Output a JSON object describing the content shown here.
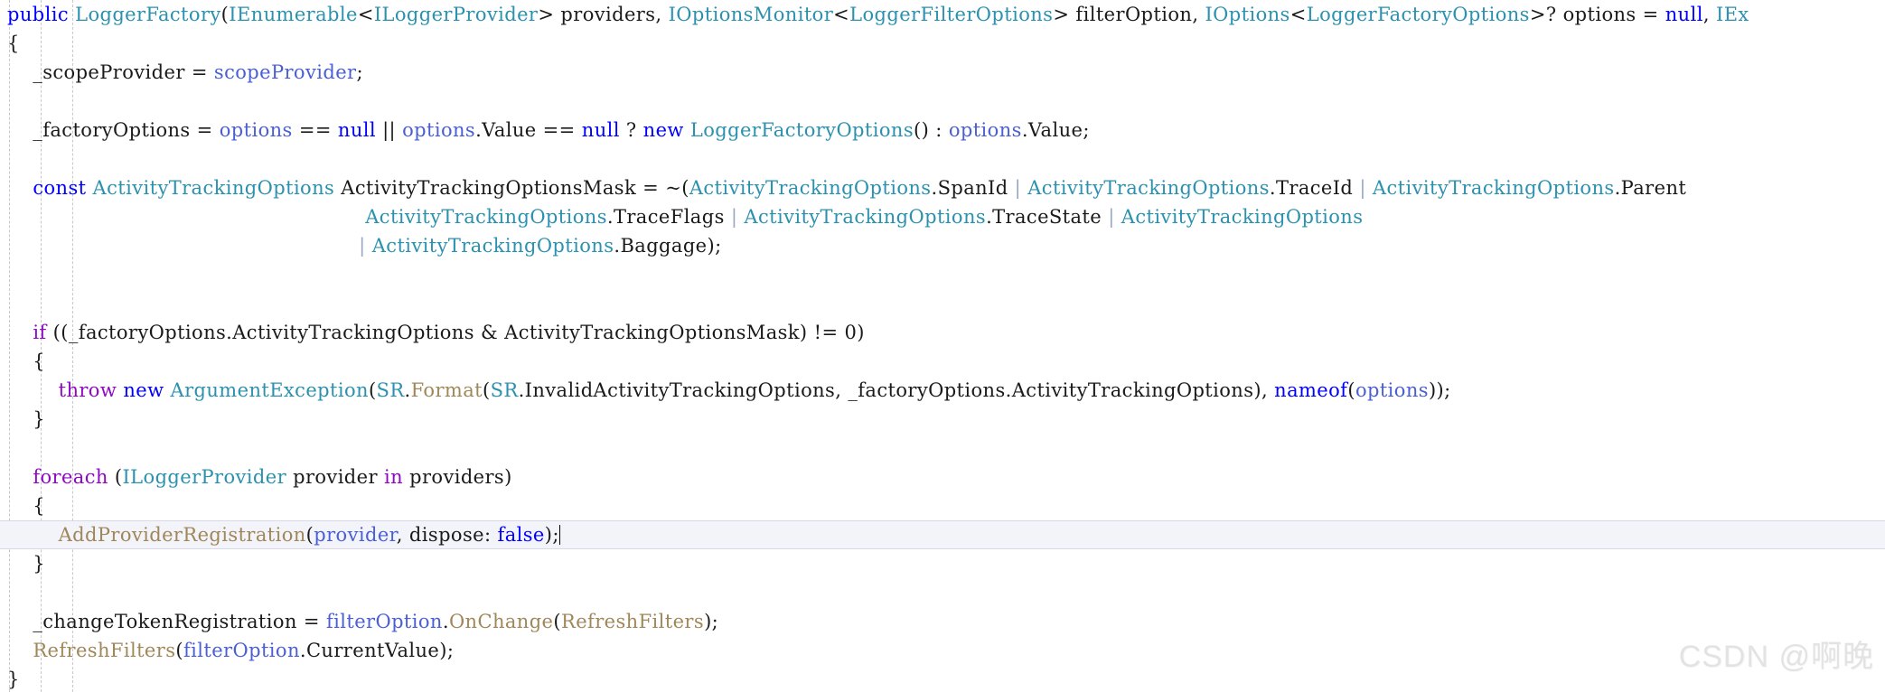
{
  "editor": {
    "language": "csharp",
    "theme": "visual-studio-light",
    "background_color": "#ffffff",
    "current_line_background": "#f3f3fa",
    "colors": {
      "keyword": "#0000ff",
      "control_keyword": "#8f08c4",
      "type": "#2b91af",
      "parameter": "#4a5fd4",
      "method": "#a08759",
      "plain_text": "#1a1a1a",
      "indent_guide": "#c8c8c8",
      "watermark": "#e3e3e3"
    }
  },
  "watermark": {
    "text": "CSDN @啊晚"
  },
  "code_lines": [
    {
      "index": 0,
      "current": false,
      "tokens": [
        {
          "t": "public",
          "c": "keyword"
        },
        {
          "t": " ",
          "c": "plain"
        },
        {
          "t": "LoggerFactory",
          "c": "type"
        },
        {
          "t": "(",
          "c": "punct"
        },
        {
          "t": "IEnumerable",
          "c": "type"
        },
        {
          "t": "<",
          "c": "punct"
        },
        {
          "t": "ILoggerProvider",
          "c": "type"
        },
        {
          "t": "> providers, ",
          "c": "plain"
        },
        {
          "t": "IOptionsMonitor",
          "c": "type"
        },
        {
          "t": "<",
          "c": "punct"
        },
        {
          "t": "LoggerFilterOptions",
          "c": "type"
        },
        {
          "t": "> filterOption, ",
          "c": "plain"
        },
        {
          "t": "IOptions",
          "c": "type"
        },
        {
          "t": "<",
          "c": "punct"
        },
        {
          "t": "LoggerFactoryOptions",
          "c": "type"
        },
        {
          "t": ">? options = ",
          "c": "plain"
        },
        {
          "t": "null",
          "c": "keyword"
        },
        {
          "t": ", ",
          "c": "plain"
        },
        {
          "t": "IEx",
          "c": "type"
        }
      ]
    },
    {
      "index": 1,
      "current": false,
      "tokens": [
        {
          "t": "{",
          "c": "punct"
        }
      ]
    },
    {
      "index": 2,
      "current": false,
      "tokens": [
        {
          "t": "    _scopeProvider = ",
          "c": "plain"
        },
        {
          "t": "scopeProvider",
          "c": "parameter"
        },
        {
          "t": ";",
          "c": "punct"
        }
      ]
    },
    {
      "index": 3,
      "current": false,
      "tokens": [
        {
          "t": "",
          "c": "plain"
        }
      ]
    },
    {
      "index": 4,
      "current": false,
      "tokens": [
        {
          "t": "    _factoryOptions = ",
          "c": "plain"
        },
        {
          "t": "options",
          "c": "parameter"
        },
        {
          "t": " == ",
          "c": "plain"
        },
        {
          "t": "null",
          "c": "keyword"
        },
        {
          "t": " || ",
          "c": "plain"
        },
        {
          "t": "options",
          "c": "parameter"
        },
        {
          "t": ".Value == ",
          "c": "plain"
        },
        {
          "t": "null",
          "c": "keyword"
        },
        {
          "t": " ? ",
          "c": "plain"
        },
        {
          "t": "new",
          "c": "keyword"
        },
        {
          "t": " ",
          "c": "plain"
        },
        {
          "t": "LoggerFactoryOptions",
          "c": "type"
        },
        {
          "t": "() : ",
          "c": "plain"
        },
        {
          "t": "options",
          "c": "parameter"
        },
        {
          "t": ".Value;",
          "c": "plain"
        }
      ]
    },
    {
      "index": 5,
      "current": false,
      "tokens": [
        {
          "t": "",
          "c": "plain"
        }
      ]
    },
    {
      "index": 6,
      "current": false,
      "tokens": [
        {
          "t": "    ",
          "c": "plain"
        },
        {
          "t": "const",
          "c": "keyword"
        },
        {
          "t": " ",
          "c": "plain"
        },
        {
          "t": "ActivityTrackingOptions",
          "c": "type"
        },
        {
          "t": " ActivityTrackingOptionsMask = ~(",
          "c": "plain"
        },
        {
          "t": "ActivityTrackingOptions",
          "c": "type"
        },
        {
          "t": ".SpanId ",
          "c": "plain"
        },
        {
          "t": "|",
          "c": "pipe"
        },
        {
          "t": " ",
          "c": "plain"
        },
        {
          "t": "ActivityTrackingOptions",
          "c": "type"
        },
        {
          "t": ".TraceId ",
          "c": "plain"
        },
        {
          "t": "|",
          "c": "pipe"
        },
        {
          "t": " ",
          "c": "plain"
        },
        {
          "t": "ActivityTrackingOptions",
          "c": "type"
        },
        {
          "t": ".Parent",
          "c": "plain"
        }
      ]
    },
    {
      "index": 7,
      "current": false,
      "tokens": [
        {
          "t": "                                                        ",
          "c": "plain"
        },
        {
          "t": "ActivityTrackingOptions",
          "c": "type"
        },
        {
          "t": ".TraceFlags ",
          "c": "plain"
        },
        {
          "t": "|",
          "c": "pipe"
        },
        {
          "t": " ",
          "c": "plain"
        },
        {
          "t": "ActivityTrackingOptions",
          "c": "type"
        },
        {
          "t": ".TraceState ",
          "c": "plain"
        },
        {
          "t": "|",
          "c": "pipe"
        },
        {
          "t": " ",
          "c": "plain"
        },
        {
          "t": "ActivityTrackingOptions",
          "c": "type"
        }
      ]
    },
    {
      "index": 8,
      "current": false,
      "tokens": [
        {
          "t": "                                                       ",
          "c": "plain"
        },
        {
          "t": "|",
          "c": "pipe"
        },
        {
          "t": " ",
          "c": "plain"
        },
        {
          "t": "ActivityTrackingOptions",
          "c": "type"
        },
        {
          "t": ".Baggage);",
          "c": "plain"
        }
      ]
    },
    {
      "index": 9,
      "current": false,
      "tokens": [
        {
          "t": "",
          "c": "plain"
        }
      ]
    },
    {
      "index": 10,
      "current": false,
      "tokens": [
        {
          "t": "",
          "c": "plain"
        }
      ]
    },
    {
      "index": 11,
      "current": false,
      "tokens": [
        {
          "t": "    ",
          "c": "plain"
        },
        {
          "t": "if",
          "c": "control"
        },
        {
          "t": " ((_factoryOptions.ActivityTrackingOptions & ActivityTrackingOptionsMask) != 0)",
          "c": "plain"
        }
      ]
    },
    {
      "index": 12,
      "current": false,
      "tokens": [
        {
          "t": "    {",
          "c": "punct"
        }
      ]
    },
    {
      "index": 13,
      "current": false,
      "tokens": [
        {
          "t": "        ",
          "c": "plain"
        },
        {
          "t": "throw",
          "c": "control"
        },
        {
          "t": " ",
          "c": "plain"
        },
        {
          "t": "new",
          "c": "keyword"
        },
        {
          "t": " ",
          "c": "plain"
        },
        {
          "t": "ArgumentException",
          "c": "type"
        },
        {
          "t": "(",
          "c": "punct"
        },
        {
          "t": "SR",
          "c": "type"
        },
        {
          "t": ".",
          "c": "punct"
        },
        {
          "t": "Format",
          "c": "method"
        },
        {
          "t": "(",
          "c": "punct"
        },
        {
          "t": "SR",
          "c": "type"
        },
        {
          "t": ".InvalidActivityTrackingOptions, _factoryOptions.ActivityTrackingOptions), ",
          "c": "plain"
        },
        {
          "t": "nameof",
          "c": "keyword"
        },
        {
          "t": "(",
          "c": "punct"
        },
        {
          "t": "options",
          "c": "parameter"
        },
        {
          "t": "));",
          "c": "punct"
        }
      ]
    },
    {
      "index": 14,
      "current": false,
      "tokens": [
        {
          "t": "    }",
          "c": "punct"
        }
      ]
    },
    {
      "index": 15,
      "current": false,
      "tokens": [
        {
          "t": "",
          "c": "plain"
        }
      ]
    },
    {
      "index": 16,
      "current": false,
      "tokens": [
        {
          "t": "    ",
          "c": "plain"
        },
        {
          "t": "foreach",
          "c": "control"
        },
        {
          "t": " (",
          "c": "punct"
        },
        {
          "t": "ILoggerProvider",
          "c": "type"
        },
        {
          "t": " provider ",
          "c": "plain"
        },
        {
          "t": "in",
          "c": "control"
        },
        {
          "t": " providers)",
          "c": "plain"
        }
      ]
    },
    {
      "index": 17,
      "current": false,
      "tokens": [
        {
          "t": "    {",
          "c": "punct"
        }
      ]
    },
    {
      "index": 18,
      "current": true,
      "tokens": [
        {
          "t": "        ",
          "c": "plain"
        },
        {
          "t": "AddProviderRegistration",
          "c": "method"
        },
        {
          "t": "(",
          "c": "punct"
        },
        {
          "t": "provider",
          "c": "parameter"
        },
        {
          "t": ", dispose: ",
          "c": "plain"
        },
        {
          "t": "false",
          "c": "keyword"
        },
        {
          "t": ");",
          "c": "punct"
        }
      ]
    },
    {
      "index": 19,
      "current": false,
      "tokens": [
        {
          "t": "    }",
          "c": "punct"
        }
      ]
    },
    {
      "index": 20,
      "current": false,
      "tokens": [
        {
          "t": "",
          "c": "plain"
        }
      ]
    },
    {
      "index": 21,
      "current": false,
      "tokens": [
        {
          "t": "    _changeTokenRegistration = ",
          "c": "plain"
        },
        {
          "t": "filterOption",
          "c": "parameter"
        },
        {
          "t": ".",
          "c": "punct"
        },
        {
          "t": "OnChange",
          "c": "method"
        },
        {
          "t": "(",
          "c": "punct"
        },
        {
          "t": "RefreshFilters",
          "c": "method"
        },
        {
          "t": ");",
          "c": "punct"
        }
      ]
    },
    {
      "index": 22,
      "current": false,
      "tokens": [
        {
          "t": "    ",
          "c": "plain"
        },
        {
          "t": "RefreshFilters",
          "c": "method"
        },
        {
          "t": "(",
          "c": "punct"
        },
        {
          "t": "filterOption",
          "c": "parameter"
        },
        {
          "t": ".CurrentValue);",
          "c": "punct"
        }
      ]
    },
    {
      "index": 23,
      "current": false,
      "tokens": [
        {
          "t": "}",
          "c": "punct"
        }
      ]
    }
  ],
  "indent_guides": [
    {
      "x": 10
    },
    {
      "x": 45
    },
    {
      "x": 80
    }
  ]
}
